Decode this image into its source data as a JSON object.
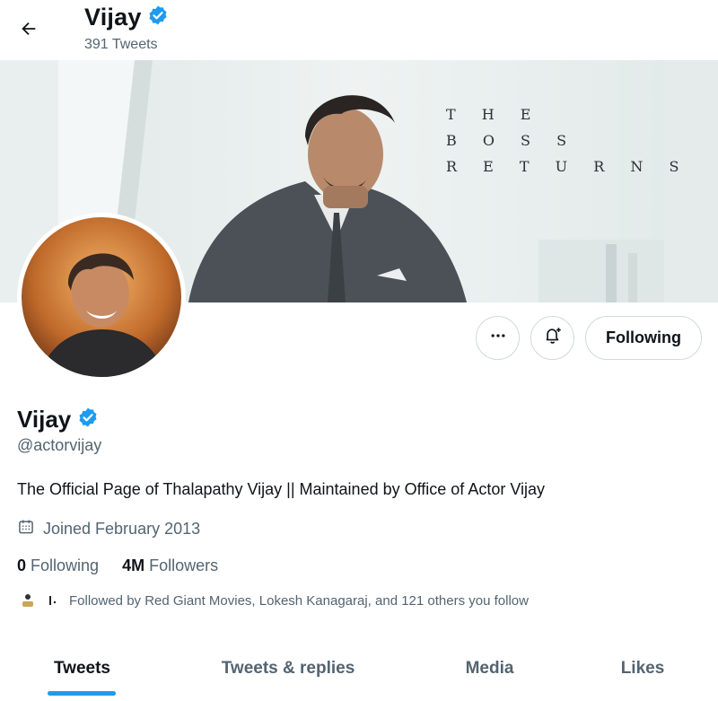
{
  "header": {
    "name": "Vijay",
    "tweet_count": "391 Tweets"
  },
  "banner": {
    "tagline_lines": [
      "T H E",
      "B O S S",
      "R E T U R N S"
    ]
  },
  "actions": {
    "following_label": "Following"
  },
  "profile": {
    "name": "Vijay",
    "handle": "@actorvijay",
    "bio": "The Official Page of Thalapathy Vijay || Maintained by Office of Actor Vijay",
    "joined": "Joined February 2013",
    "following_count": "0",
    "following_label": "Following",
    "followers_count": "4M",
    "followers_label": "Followers",
    "followed_by": "Followed by Red Giant Movies, Lokesh Kanagaraj, and 121 others you follow"
  },
  "tabs": [
    {
      "label": "Tweets",
      "active": true
    },
    {
      "label": "Tweets & replies",
      "active": false
    },
    {
      "label": "Media",
      "active": false
    },
    {
      "label": "Likes",
      "active": false
    }
  ],
  "colors": {
    "accent": "#1d9bf0",
    "text_primary": "#0f1419",
    "text_secondary": "#536471",
    "border": "#cfd9de"
  },
  "icons": {
    "back": "back-arrow-icon",
    "verified": "verified-badge-icon",
    "more": "more-dots-icon",
    "notify": "bell-plus-icon",
    "calendar": "calendar-icon"
  }
}
